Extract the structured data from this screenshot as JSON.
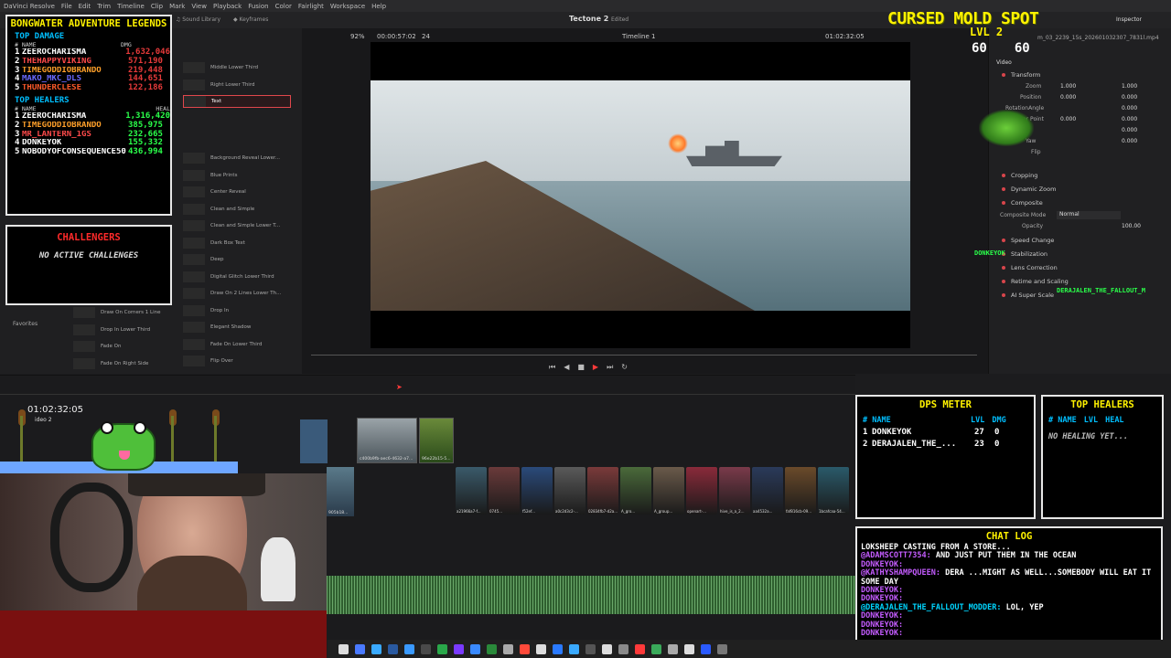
{
  "app": {
    "menu": [
      "DaVinci Resolve",
      "File",
      "Edit",
      "Trim",
      "Timeline",
      "Clip",
      "Mark",
      "View",
      "Playback",
      "Fusion",
      "Color",
      "Fairlight",
      "Workspace",
      "Help"
    ],
    "toolbar": {
      "sound_library": "Sound Library",
      "keyframes": "Keyframes",
      "inspector": "Inspector"
    },
    "project_title": "Tectone 2",
    "project_status": "Edited",
    "zoom": "92%",
    "src_timecode": "00:00:57:02",
    "fps": "24",
    "timeline_name": "Timeline 1",
    "rec_timecode": "01:02:32:05",
    "file_name": "m_03_2239_15s_202601032307_7831l.mp4",
    "playhead_timecode": "01:02:32:05",
    "track_label": "ideo 2",
    "favorites": "Favorites"
  },
  "effects_list": {
    "col1": [
      "Draw On Corners 1 Line",
      "Drop In Lower Third",
      "Fade On",
      "Fade On Right Side"
    ],
    "col2": [
      "Middle Lower Third",
      "Right Lower Third",
      "Text",
      "Background Reveal Lower...",
      "Blue Prints",
      "Center Reveal",
      "Clean and Simple",
      "Clean and Simple Lower T...",
      "Dark Box Text",
      "Deep",
      "Digital Glitch Lower Third",
      "Draw On 2 Lines Lower Th...",
      "Drop In",
      "Elegant Shadow",
      "Fade On Lower Third",
      "Flip Over"
    ],
    "selected": "Text"
  },
  "inspector": {
    "tabs": [
      "Video"
    ],
    "sections": [
      "Transform",
      "Cropping",
      "Dynamic Zoom",
      "Composite",
      "Speed Change",
      "Stabilization",
      "Lens Correction",
      "Retime and Scaling",
      "AI Super Scale"
    ],
    "transform": {
      "zoom_label": "Zoom",
      "zoom_x": "1.000",
      "zoom_y": "1.000",
      "position_label": "Position",
      "pos_x": "0.000",
      "pos_y": "0.000",
      "rotation_label": "RotationAngle",
      "rotation": "0.000",
      "anchor_label": "Anchor Point",
      "anchor_x": "0.000",
      "anchor_y": "0.000",
      "pitch": "0.000",
      "yaw": "0.000",
      "yaw_label": "Yaw",
      "flip_label": "Flip"
    },
    "composite": {
      "mode_label": "Composite Mode",
      "mode": "Normal",
      "opacity_label": "Opacity",
      "opacity": "100.00"
    }
  },
  "clips_top": [
    "c400b9fb-aec6-4632-a7...",
    "96e22b15-5..."
  ],
  "clips_bottom": [
    "a21966a7-f...",
    "0745...",
    "f52ef...",
    "a0c2d3c2-...",
    "02834fb7-d2a...",
    "A_gro...",
    "A_group...",
    "openart-...",
    "hive_is_a_2...",
    "aa4532a...",
    "faf816cb-09...",
    "1bcafcaa-54..."
  ],
  "clip_left": "905b18...",
  "leaderboard": {
    "title": "BONGWATER ADVENTURE LEGENDS",
    "damage_header": "TOP DAMAGE",
    "col_name": "# NAME",
    "col_dmg": "DMG",
    "damage": [
      {
        "n": "1",
        "name": "ZEEROCHARISMA",
        "val": "1,632,046",
        "color": "#e63a3a",
        "name_color": "#ffffff"
      },
      {
        "n": "2",
        "name": "THEHAPPYVIKING",
        "val": "571,190",
        "color": "#e63a3a",
        "name_color": "#ff4a4a"
      },
      {
        "n": "3",
        "name": "TIMEGODDIOBRANDO",
        "val": "219,448",
        "color": "#e63a3a",
        "name_color": "#ffa02a"
      },
      {
        "n": "4",
        "name": "MAKO_MKC_DLS",
        "val": "144,651",
        "color": "#e63a3a",
        "name_color": "#6a6aff"
      },
      {
        "n": "5",
        "name": "THUNDERCLESE",
        "val": "122,186",
        "color": "#e63a3a",
        "name_color": "#ff5a2a"
      }
    ],
    "healers_header": "TOP HEALERS",
    "col_heal": "HEAL",
    "healers": [
      {
        "n": "1",
        "name": "ZEEROCHARISMA",
        "val": "1,316,420",
        "color": "#2aff4a",
        "name_color": "#ffffff"
      },
      {
        "n": "2",
        "name": "TIMEGODDIOBRANDO",
        "val": "385,975",
        "color": "#2aff4a",
        "name_color": "#ffa02a"
      },
      {
        "n": "3",
        "name": "MR_LANTERN_1GS",
        "val": "232,665",
        "color": "#2aff4a",
        "name_color": "#ff4a4a"
      },
      {
        "n": "4",
        "name": "DONKEYOK",
        "val": "155,332",
        "color": "#2aff4a",
        "name_color": "#ffffff"
      },
      {
        "n": "5",
        "name": "NOBODYOFCONSEQUENCE50",
        "val": "436,994",
        "color": "#2aff4a",
        "name_color": "#ffffff"
      }
    ]
  },
  "challengers": {
    "title": "CHALLENGERS",
    "body": "NO ACTIVE CHALLENGES"
  },
  "boss": {
    "name": "CURSED MOLD SPOT",
    "level": "LVL 2",
    "count_a": "60",
    "count_b": "60",
    "player_tag": "DONKEYOK",
    "player_tag2": "DERAJALEN_THE_FALLOUT_M"
  },
  "dps_meter": {
    "title": "DPS METER",
    "cols": [
      "# NAME",
      "LVL",
      "DMG"
    ],
    "rows": [
      {
        "n": "1",
        "name": "DONKEYOK",
        "lvl": "27",
        "dmg": "0"
      },
      {
        "n": "2",
        "name": "DERAJALEN_THE_...",
        "lvl": "23",
        "dmg": "0"
      }
    ]
  },
  "top_healers_box": {
    "title": "TOP HEALERS",
    "cols": [
      "# NAME",
      "LVL",
      "HEAL"
    ],
    "empty": "NO HEALING YET..."
  },
  "chat": {
    "title": "CHAT LOG",
    "lines": [
      {
        "user": "",
        "text": "LOKSHEEP CASTING FROM A STORE...",
        "cls": "cu"
      },
      {
        "user": "@ADAMSCOTT7354:",
        "text": " AND JUST PUT THEM IN THE OCEAN",
        "cls": "cu"
      },
      {
        "user": "DONKEYOK:",
        "text": "",
        "cls": "cu"
      },
      {
        "user": "@KATHYSHAMPQUEEN:",
        "text": " DERA ...MIGHT AS WELL...SOMEBODY WILL EAT IT SOME DAY",
        "cls": "cu"
      },
      {
        "user": "DONKEYOK:",
        "text": "",
        "cls": "cu"
      },
      {
        "user": "DONKEYOK:",
        "text": "",
        "cls": "cu"
      },
      {
        "user": "@DERAJALEN_THE_FALLOUT_MODDER:",
        "text": " LOL, YEP",
        "cls": "cu2"
      },
      {
        "user": "DONKEYOK:",
        "text": "",
        "cls": "cu"
      },
      {
        "user": "DONKEYOK:",
        "text": "",
        "cls": "cu"
      },
      {
        "user": "DONKEYOK:",
        "text": "",
        "cls": "cu"
      }
    ]
  },
  "colors": {
    "accent": "#d8454b",
    "overlay_yellow": "#fff200",
    "overlay_blue": "#00bfff"
  }
}
